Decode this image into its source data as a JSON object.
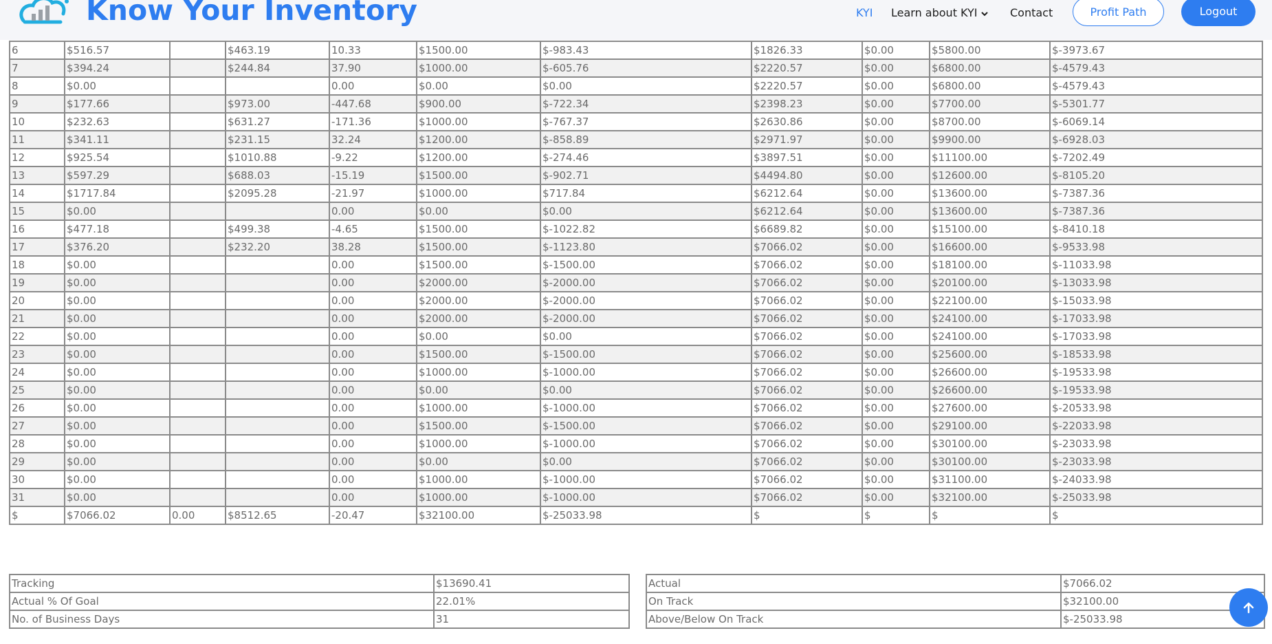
{
  "header": {
    "brand": "Know Your Inventory",
    "nav": {
      "kyi": "KYI",
      "learn": "Learn about KYI",
      "contact": "Contact"
    },
    "profit_path": "Profit Path",
    "logout": "Logout"
  },
  "colors": {
    "accent": "#2e7df0",
    "row_alt": "#f1f1f1",
    "border": "#8a8a8a",
    "text": "#6b6b6b"
  },
  "table": {
    "rows": [
      [
        "6",
        "$516.57",
        "",
        "$463.19",
        "10.33",
        "$1500.00",
        "$-983.43",
        "$1826.33",
        "$0.00",
        "$5800.00",
        "$-3973.67"
      ],
      [
        "7",
        "$394.24",
        "",
        "$244.84",
        "37.90",
        "$1000.00",
        "$-605.76",
        "$2220.57",
        "$0.00",
        "$6800.00",
        "$-4579.43"
      ],
      [
        "8",
        "$0.00",
        "",
        "",
        "0.00",
        "$0.00",
        "$0.00",
        "$2220.57",
        "$0.00",
        "$6800.00",
        "$-4579.43"
      ],
      [
        "9",
        "$177.66",
        "",
        "$973.00",
        "-447.68",
        "$900.00",
        "$-722.34",
        "$2398.23",
        "$0.00",
        "$7700.00",
        "$-5301.77"
      ],
      [
        "10",
        "$232.63",
        "",
        "$631.27",
        "-171.36",
        "$1000.00",
        "$-767.37",
        "$2630.86",
        "$0.00",
        "$8700.00",
        "$-6069.14"
      ],
      [
        "11",
        "$341.11",
        "",
        "$231.15",
        "32.24",
        "$1200.00",
        "$-858.89",
        "$2971.97",
        "$0.00",
        "$9900.00",
        "$-6928.03"
      ],
      [
        "12",
        "$925.54",
        "",
        "$1010.88",
        "-9.22",
        "$1200.00",
        "$-274.46",
        "$3897.51",
        "$0.00",
        "$11100.00",
        "$-7202.49"
      ],
      [
        "13",
        "$597.29",
        "",
        "$688.03",
        "-15.19",
        "$1500.00",
        "$-902.71",
        "$4494.80",
        "$0.00",
        "$12600.00",
        "$-8105.20"
      ],
      [
        "14",
        "$1717.84",
        "",
        "$2095.28",
        "-21.97",
        "$1000.00",
        "$717.84",
        "$6212.64",
        "$0.00",
        "$13600.00",
        "$-7387.36"
      ],
      [
        "15",
        "$0.00",
        "",
        "",
        "0.00",
        "$0.00",
        "$0.00",
        "$6212.64",
        "$0.00",
        "$13600.00",
        "$-7387.36"
      ],
      [
        "16",
        "$477.18",
        "",
        "$499.38",
        "-4.65",
        "$1500.00",
        "$-1022.82",
        "$6689.82",
        "$0.00",
        "$15100.00",
        "$-8410.18"
      ],
      [
        "17",
        "$376.20",
        "",
        "$232.20",
        "38.28",
        "$1500.00",
        "$-1123.80",
        "$7066.02",
        "$0.00",
        "$16600.00",
        "$-9533.98"
      ],
      [
        "18",
        "$0.00",
        "",
        "",
        "0.00",
        "$1500.00",
        "$-1500.00",
        "$7066.02",
        "$0.00",
        "$18100.00",
        "$-11033.98"
      ],
      [
        "19",
        "$0.00",
        "",
        "",
        "0.00",
        "$2000.00",
        "$-2000.00",
        "$7066.02",
        "$0.00",
        "$20100.00",
        "$-13033.98"
      ],
      [
        "20",
        "$0.00",
        "",
        "",
        "0.00",
        "$2000.00",
        "$-2000.00",
        "$7066.02",
        "$0.00",
        "$22100.00",
        "$-15033.98"
      ],
      [
        "21",
        "$0.00",
        "",
        "",
        "0.00",
        "$2000.00",
        "$-2000.00",
        "$7066.02",
        "$0.00",
        "$24100.00",
        "$-17033.98"
      ],
      [
        "22",
        "$0.00",
        "",
        "",
        "0.00",
        "$0.00",
        "$0.00",
        "$7066.02",
        "$0.00",
        "$24100.00",
        "$-17033.98"
      ],
      [
        "23",
        "$0.00",
        "",
        "",
        "0.00",
        "$1500.00",
        "$-1500.00",
        "$7066.02",
        "$0.00",
        "$25600.00",
        "$-18533.98"
      ],
      [
        "24",
        "$0.00",
        "",
        "",
        "0.00",
        "$1000.00",
        "$-1000.00",
        "$7066.02",
        "$0.00",
        "$26600.00",
        "$-19533.98"
      ],
      [
        "25",
        "$0.00",
        "",
        "",
        "0.00",
        "$0.00",
        "$0.00",
        "$7066.02",
        "$0.00",
        "$26600.00",
        "$-19533.98"
      ],
      [
        "26",
        "$0.00",
        "",
        "",
        "0.00",
        "$1000.00",
        "$-1000.00",
        "$7066.02",
        "$0.00",
        "$27600.00",
        "$-20533.98"
      ],
      [
        "27",
        "$0.00",
        "",
        "",
        "0.00",
        "$1500.00",
        "$-1500.00",
        "$7066.02",
        "$0.00",
        "$29100.00",
        "$-22033.98"
      ],
      [
        "28",
        "$0.00",
        "",
        "",
        "0.00",
        "$1000.00",
        "$-1000.00",
        "$7066.02",
        "$0.00",
        "$30100.00",
        "$-23033.98"
      ],
      [
        "29",
        "$0.00",
        "",
        "",
        "0.00",
        "$0.00",
        "$0.00",
        "$7066.02",
        "$0.00",
        "$30100.00",
        "$-23033.98"
      ],
      [
        "30",
        "$0.00",
        "",
        "",
        "0.00",
        "$1000.00",
        "$-1000.00",
        "$7066.02",
        "$0.00",
        "$31100.00",
        "$-24033.98"
      ],
      [
        "31",
        "$0.00",
        "",
        "",
        "0.00",
        "$1000.00",
        "$-1000.00",
        "$7066.02",
        "$0.00",
        "$32100.00",
        "$-25033.98"
      ],
      [
        "$",
        "$7066.02",
        "0.00",
        "$8512.65",
        "-20.47",
        "$32100.00",
        "$-25033.98",
        "$",
        "$",
        "$",
        "$"
      ]
    ]
  },
  "summary_left": [
    {
      "label": "Tracking",
      "value": "$13690.41"
    },
    {
      "label": "Actual % Of Goal",
      "value": "22.01%"
    },
    {
      "label": "No. of Business Days",
      "value": "31"
    }
  ],
  "summary_right": [
    {
      "label": "Actual",
      "value": "$7066.02"
    },
    {
      "label": "On Track",
      "value": "$32100.00"
    },
    {
      "label": "Above/Below On Track",
      "value": "$-25033.98"
    }
  ],
  "scroll_top_icon": "arrow-up-icon"
}
